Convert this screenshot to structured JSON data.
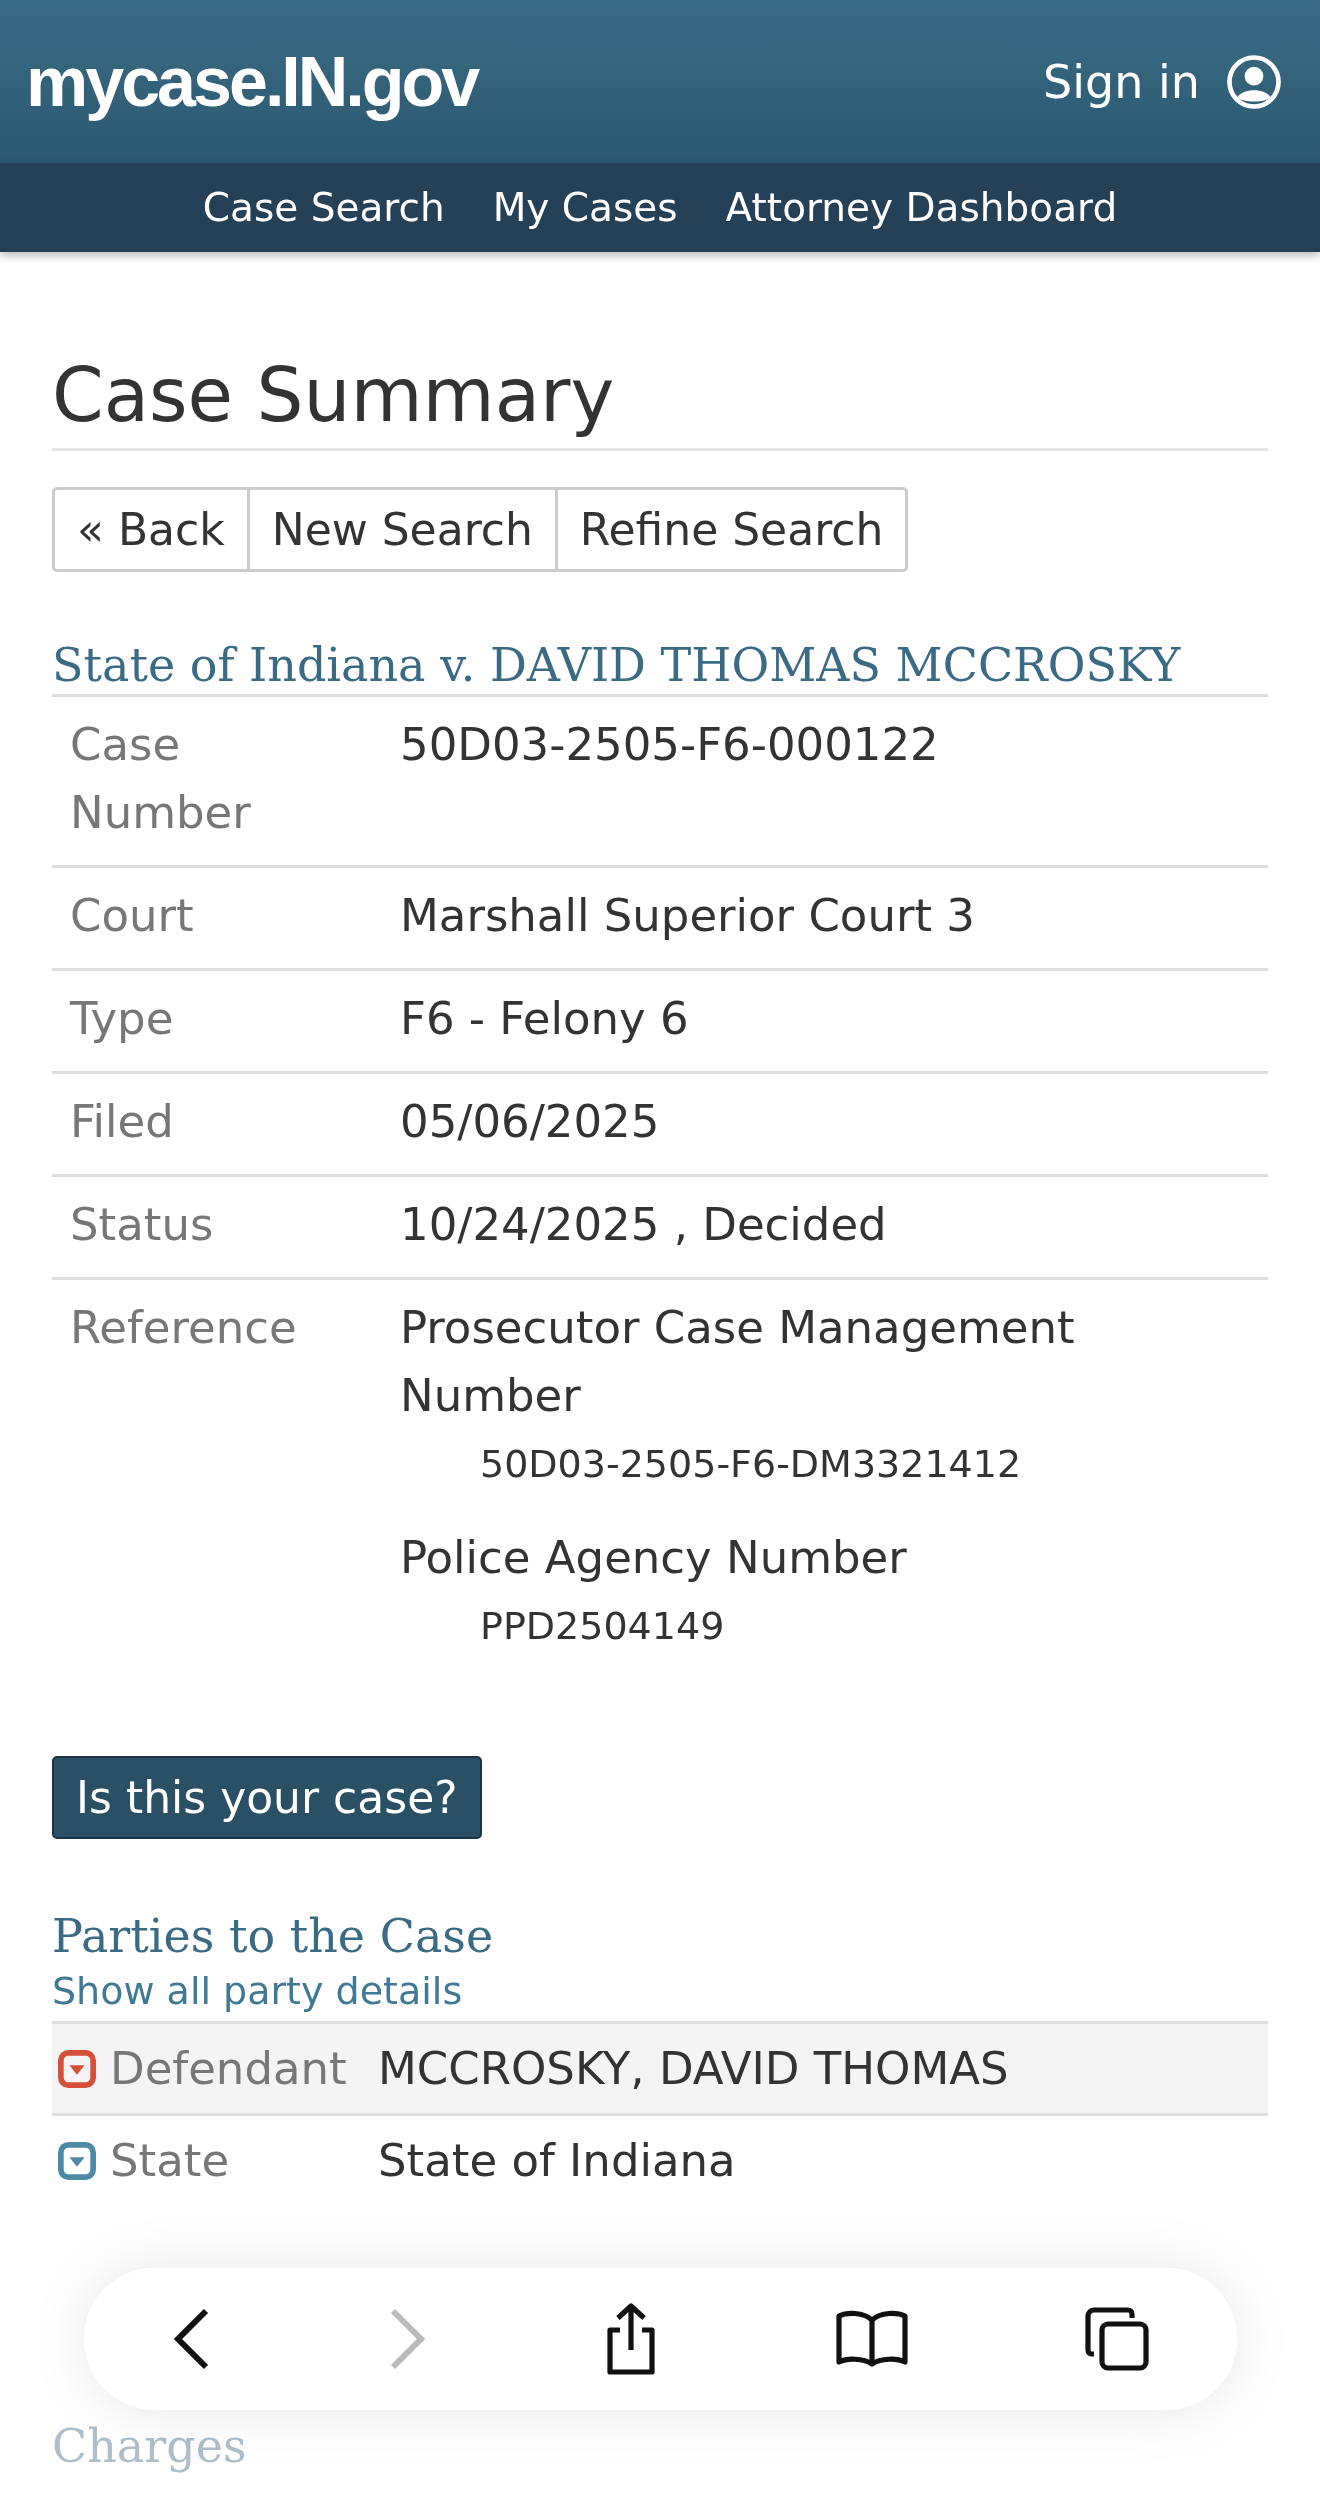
{
  "header": {
    "logo": "mycase.IN.gov",
    "sign_in": "Sign in"
  },
  "nav": [
    {
      "label": "Case Search"
    },
    {
      "label": "My Cases"
    },
    {
      "label": "Attorney Dashboard"
    }
  ],
  "page_title": "Case Summary",
  "buttons": [
    "« Back",
    "New Search",
    "Refine Search"
  ],
  "case_title": "State of Indiana v. DAVID THOMAS MCCROSKY",
  "details": [
    {
      "label": "Case Number",
      "value": "50D03-2505-F6-000122"
    },
    {
      "label": "Court",
      "value": "Marshall Superior Court 3"
    },
    {
      "label": "Type",
      "value": "F6 - Felony 6"
    },
    {
      "label": "Filed",
      "value": "05/06/2025"
    },
    {
      "label": "Status",
      "value": "10/24/2025 , Decided"
    }
  ],
  "reference": {
    "label": "Reference",
    "items": [
      {
        "name": "Prosecutor Case Management Number",
        "number": "50D03-2505-F6-DM3321412"
      },
      {
        "name": "Police Agency Number",
        "number": "PPD2504149"
      }
    ]
  },
  "claim_button": "Is this your case?",
  "parties": {
    "heading": "Parties to the Case",
    "link": "Show all party details",
    "rows": [
      {
        "role": "Defendant",
        "name": "MCCROSKY, DAVID THOMAS",
        "color": "#d4503a",
        "selected": true
      },
      {
        "role": "State",
        "name": "State of Indiana",
        "color": "#4d8aa6",
        "selected": false
      }
    ]
  },
  "charges": {
    "heading": "Charges"
  }
}
